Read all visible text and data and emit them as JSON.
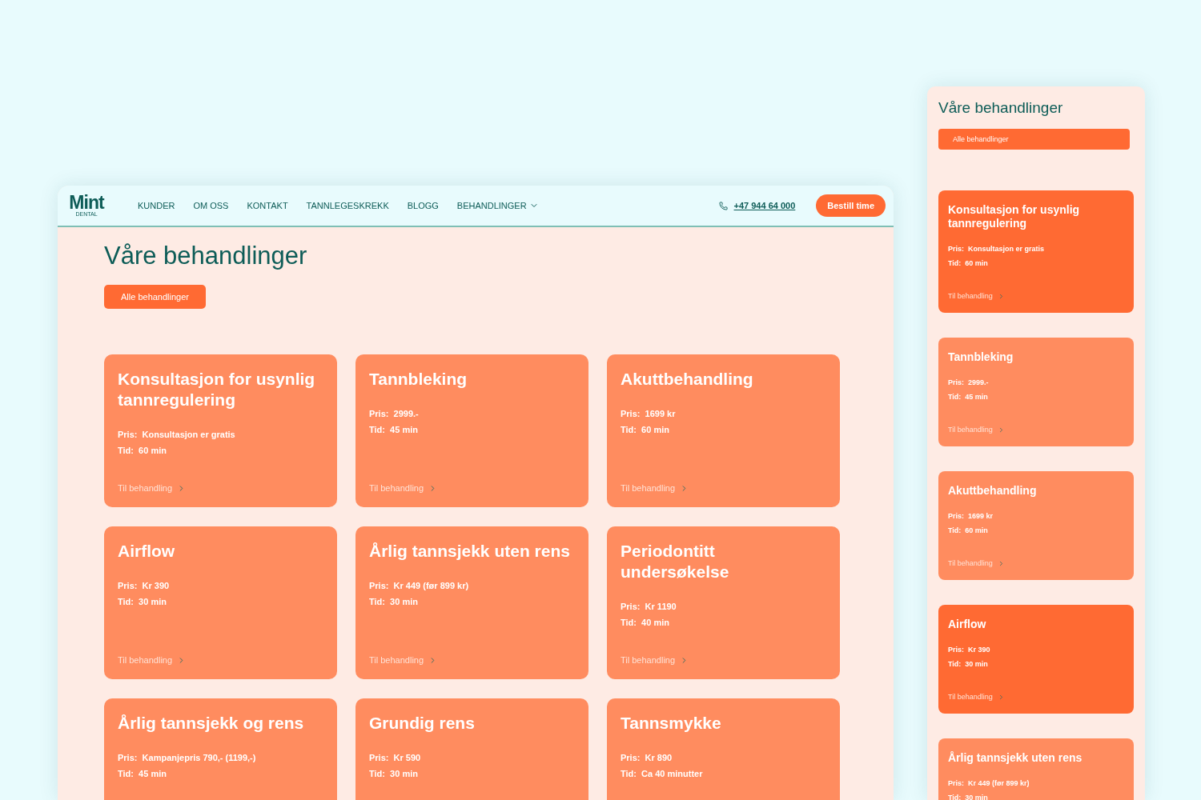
{
  "desktop": {
    "nav": {
      "logo": "Mint",
      "logo_sub": "DENTAL",
      "links": [
        {
          "label": "KUNDER",
          "dropdown": false
        },
        {
          "label": "OM OSS",
          "dropdown": false
        },
        {
          "label": "KONTAKT",
          "dropdown": false
        },
        {
          "label": "TANNLEGESKREKK",
          "dropdown": false
        },
        {
          "label": "BLOGG",
          "dropdown": false
        },
        {
          "label": "BEHANDLINGER",
          "dropdown": true
        }
      ],
      "phone": "+47 944 64 000",
      "cta": "Bestill time"
    },
    "heading": "Våre behandlinger",
    "filter_button": "Alle behandlinger",
    "cards": [
      {
        "title": "Konsultasjon for usynlig tannregulering",
        "price_label": "Pris:",
        "price": "Konsultasjon er gratis",
        "time_label": "Tid:",
        "time": "60 min",
        "link": "Til behandling"
      },
      {
        "title": "Tannbleking",
        "price_label": "Pris:",
        "price": "2999.-",
        "time_label": "Tid:",
        "time": "45 min",
        "link": "Til behandling"
      },
      {
        "title": "Akuttbehandling",
        "price_label": "Pris:",
        "price": "1699 kr",
        "time_label": "Tid:",
        "time": "60 min",
        "link": "Til behandling"
      },
      {
        "title": "Airflow",
        "price_label": "Pris:",
        "price": "Kr 390",
        "time_label": "Tid:",
        "time": "30 min",
        "link": "Til behandling"
      },
      {
        "title": "Årlig tannsjekk uten rens",
        "price_label": "Pris:",
        "price": "Kr 449 (før 899 kr)",
        "time_label": "Tid:",
        "time": "30 min",
        "link": "Til behandling"
      },
      {
        "title": "Periodontitt undersøkelse",
        "price_label": "Pris:",
        "price": "Kr 1190",
        "time_label": "Tid:",
        "time": "40 min",
        "link": "Til behandling"
      },
      {
        "title": "Årlig tannsjekk og rens",
        "price_label": "Pris:",
        "price": "Kampanjepris 790,- (1199,-)",
        "time_label": "Tid:",
        "time": "45 min"
      },
      {
        "title": "Grundig rens",
        "price_label": "Pris:",
        "price": "Kr 590",
        "time_label": "Tid:",
        "time": "30 min"
      },
      {
        "title": "Tannsmykke",
        "price_label": "Pris:",
        "price": "Kr 890",
        "time_label": "Tid:",
        "time": "Ca 40 minutter"
      }
    ]
  },
  "mobile": {
    "heading": "Våre behandlinger",
    "filter_button": "Alle behandlinger",
    "cards": [
      {
        "title": "Konsultasjon for usynlig tannregulering",
        "price_label": "Pris:",
        "price": "Konsultasjon er gratis",
        "time_label": "Tid:",
        "time": "60 min",
        "link": "Til behandling",
        "highlighted": true
      },
      {
        "title": "Tannbleking",
        "price_label": "Pris:",
        "price": "2999.-",
        "time_label": "Tid:",
        "time": "45 min",
        "link": "Til behandling",
        "highlighted": false
      },
      {
        "title": "Akuttbehandling",
        "price_label": "Pris:",
        "price": "1699 kr",
        "time_label": "Tid:",
        "time": "60 min",
        "link": "Til behandling",
        "highlighted": false
      },
      {
        "title": "Airflow",
        "price_label": "Pris:",
        "price": "Kr 390",
        "time_label": "Tid:",
        "time": "30 min",
        "link": "Til behandling",
        "highlighted": true
      },
      {
        "title": "Årlig tannsjekk uten rens",
        "price_label": "Pris:",
        "price": "Kr 449 (før 899 kr)",
        "time_label": "Tid:",
        "time": "30 min",
        "highlighted": false
      }
    ]
  }
}
